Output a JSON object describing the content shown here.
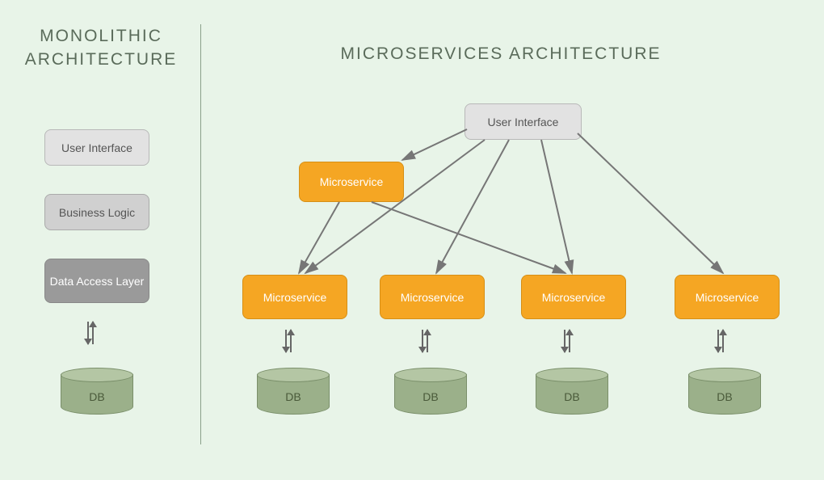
{
  "monolithic": {
    "title": "MONOLITHIC ARCHITECTURE",
    "layers": {
      "ui": "User Interface",
      "logic": "Business Logic",
      "data": "Data Access Layer"
    },
    "db": "DB"
  },
  "microservices": {
    "title": "MICROSERVICES ARCHITECTURE",
    "ui": "User Interface",
    "service_top": "Microservice",
    "services": [
      "Microservice",
      "Microservice",
      "Microservice",
      "Microservice"
    ],
    "db": "DB"
  }
}
